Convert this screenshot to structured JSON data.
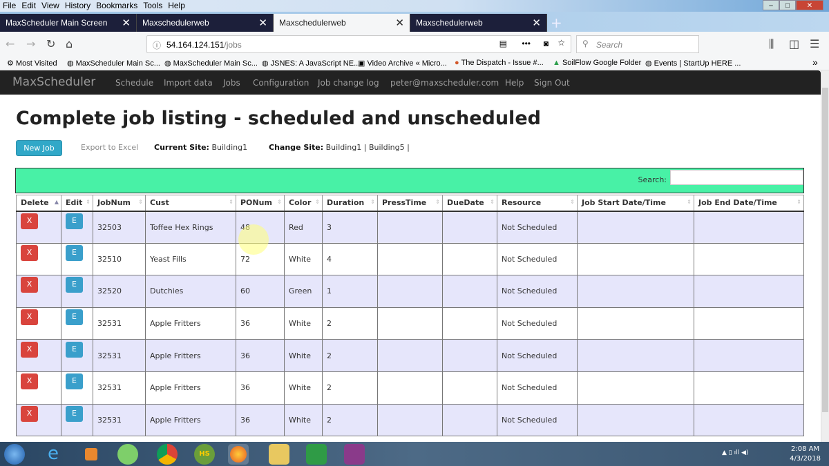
{
  "browser": {
    "menu": [
      "File",
      "Edit",
      "View",
      "History",
      "Bookmarks",
      "Tools",
      "Help"
    ],
    "tabs": [
      {
        "label": "MaxScheduler Main Screen"
      },
      {
        "label": "Maxschedulerweb"
      },
      {
        "label": "Maxschedulerweb"
      },
      {
        "label": "Maxschedulerweb"
      }
    ],
    "url_host": "54.164.124.151",
    "url_path": "/jobs",
    "search_placeholder": "Search",
    "bookmarks": [
      "Most Visited",
      "MaxScheduler Main Sc...",
      "MaxScheduler Main Sc...",
      "JSNES: A JavaScript NE...",
      "Video Archive « Micro...",
      "The Dispatch - Issue #...",
      "SoilFlow Google Folder",
      "Events | StartUp HERE ..."
    ]
  },
  "app": {
    "brand": "MaxScheduler",
    "nav": [
      "Schedule",
      "Import data",
      "Jobs",
      "Configuration",
      "Job change log",
      "peter@maxscheduler.com",
      "Help",
      "Sign Out"
    ]
  },
  "page": {
    "title": "Complete job listing - scheduled and unscheduled",
    "new_job": "New Job",
    "export": "Export to Excel",
    "current_site_label": "Current Site:",
    "current_site": "Building1",
    "change_site_label": "Change Site:",
    "sites": "Building1  |  Building5  |",
    "search_label": "Search:"
  },
  "table": {
    "headers": [
      "Delete",
      "Edit",
      "JobNum",
      "Cust",
      "PONum",
      "Color",
      "Duration",
      "PressTime",
      "DueDate",
      "Resource",
      "Job Start Date/Time",
      "Job End Date/Time"
    ],
    "delete_label": "X",
    "edit_label": "E",
    "rows": [
      [
        "32503",
        "Toffee Hex Rings",
        "48",
        "Red",
        "3",
        "",
        "",
        "Not Scheduled",
        "",
        ""
      ],
      [
        "32510",
        "Yeast Fills",
        "72",
        "White",
        "4",
        "",
        "",
        "Not Scheduled",
        "",
        ""
      ],
      [
        "32520",
        "Dutchies",
        "60",
        "Green",
        "1",
        "",
        "",
        "Not Scheduled",
        "",
        ""
      ],
      [
        "32531",
        "Apple Fritters",
        "36",
        "White",
        "2",
        "",
        "",
        "Not Scheduled",
        "",
        ""
      ],
      [
        "32531",
        "Apple Fritters",
        "36",
        "White",
        "2",
        "",
        "",
        "Not Scheduled",
        "",
        ""
      ],
      [
        "32531",
        "Apple Fritters",
        "36",
        "White",
        "2",
        "",
        "",
        "Not Scheduled",
        "",
        ""
      ],
      [
        "32531",
        "Apple Fritters",
        "36",
        "White",
        "2",
        "",
        "",
        "Not Scheduled",
        "",
        ""
      ]
    ]
  },
  "taskbar": {
    "time": "2:08 AM",
    "date": "4/3/2018"
  }
}
